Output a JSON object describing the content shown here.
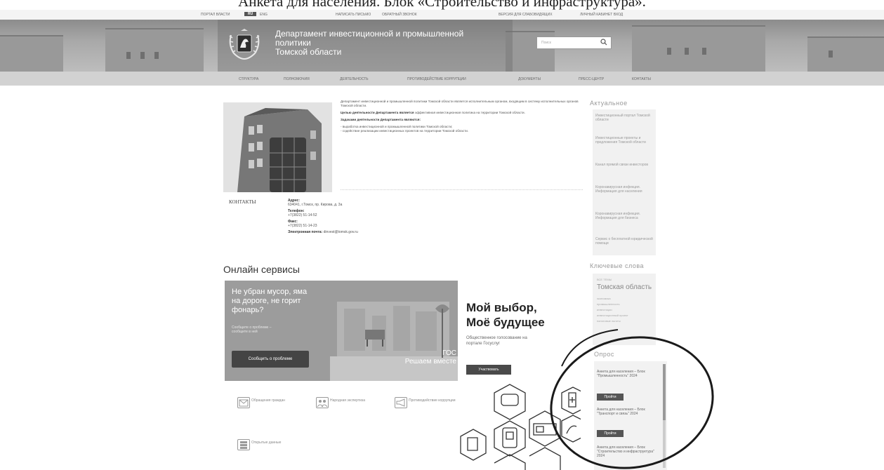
{
  "heading": "Анкета для населения. Блок «Строительство и инфраструктура».",
  "topbar": {
    "site_link": "ПОРТАЛ ВЛАСТИ",
    "lang_ru": "RU",
    "lang_other": "ENG",
    "email_link": "НАПИСАТЬ ПИСЬМО",
    "phone_link": "ОБРАТНЫЙ ЗВОНОК",
    "accessibility_link": "ВЕРСИЯ ДЛЯ СЛАБОВИДЯЩИХ",
    "login_link": "ЛИЧНЫЙ КАБИНЕТ ВХОД"
  },
  "header": {
    "title": "Департамент инвестиционной и промышленной политики Томской области",
    "title_lines": [
      "Департамент инвестиционной и промышленной",
      "политики",
      "Томской области"
    ],
    "search_placeholder": "Поиск"
  },
  "nav": {
    "items": [
      "СТРУКТУРА",
      "ПОЛНОМОЧИЯ",
      "ДЕЯТЕЛЬНОСТЬ",
      "ПРОТИВОДЕЙСТВИЕ КОРРУПЦИИ",
      "ДОКУМЕНТЫ",
      "ПРЕСС-ЦЕНТР",
      "КОНТАКТЫ"
    ]
  },
  "intro": {
    "p1": "Департамент инвестиционной и промышленной политики Томской области является исполнительным органом, входящим в систему исполнительных органов Томской области.",
    "p2_bold": "Целью деятельности Департамента является",
    "p2_rest": " эффективная инвестиционная политика на территории Томской области.",
    "p3_bold": "Задачами деятельности Департамента являются:",
    "tasks": [
      "- выработка инвестиционной и промышленной политики Томской области;",
      "- содействие реализации инвестиционных проектов на территории Томской области."
    ]
  },
  "contacts": {
    "title": "КОНТАКТЫ",
    "address_label": "Адрес:",
    "address_value": "634041, г.Томск, пр. Кирова, д. 3а",
    "phone_label": "Телефон:",
    "phone_value": "+7(3822) 51-14-52",
    "fax_label": "Факс:",
    "fax_value": "+7(3822) 51-14-23",
    "email_label": "Электронная почта:",
    "email_value": "dinvest@tomsk.gov.ru"
  },
  "online": {
    "title": "Онлайн сервисы",
    "promo1": {
      "headline_lines": [
        "Не убран мусор, яма",
        "на дороге, не горит",
        "фонарь?"
      ],
      "sub_lines": [
        "Сообщите о проблеме –",
        "сообщите в ней"
      ],
      "button": "Сообщить о проблеме",
      "gos": "ГОС",
      "gos_sub": "Решаем вместе"
    },
    "promo2": {
      "headline_lines": [
        "Мой выбор,",
        "Моё будущее"
      ],
      "sub_lines": [
        "Общественное голосование на",
        "портале Госуслуг"
      ],
      "button": "Участвовать"
    },
    "services": [
      {
        "label": "Обращения граждан",
        "icon": "appeal-icon"
      },
      {
        "label": "Народная экспертиза",
        "icon": "people-icon"
      },
      {
        "label": "Противодействие коррупции",
        "icon": "megaphone-icon"
      },
      {
        "label": "Открытые данные",
        "icon": "data-icon"
      }
    ]
  },
  "sidebar": {
    "actual_title": "Актуальное",
    "links": [
      "Инвестиционный портал Томской области",
      "Инвестиционные проекты и предложения Томской области",
      "Канал прямой связи инвесторов",
      "Коронавирусная инфекция. Информация для населения",
      "Коронавирусная инфекция. Информация для бизнеса",
      "Сервис о бесплатной юридической помощи"
    ],
    "keywords_title": "Ключевые слова",
    "keywords_top": "ВСЕ ТЕМЫ",
    "keywords_main": "Томская область",
    "keywords_items": [
      "экономика",
      "промышленность",
      "инвестиции",
      "инвестиционный проект",
      "налоговые льготы"
    ],
    "keywords_more": "Все темы",
    "poll_title": "Опрос",
    "polls": [
      {
        "text": "Анкета для населения – Блок \"Промышленность\" 2024",
        "button": "Пройти"
      },
      {
        "text": "Анкета для населения – Блок \"Транспорт и связь\" 2024",
        "button": "Пройти"
      },
      {
        "text": "Анкета для населения – Блок \"Строительство и инфраструктура\" 2024",
        "button": ""
      }
    ]
  }
}
